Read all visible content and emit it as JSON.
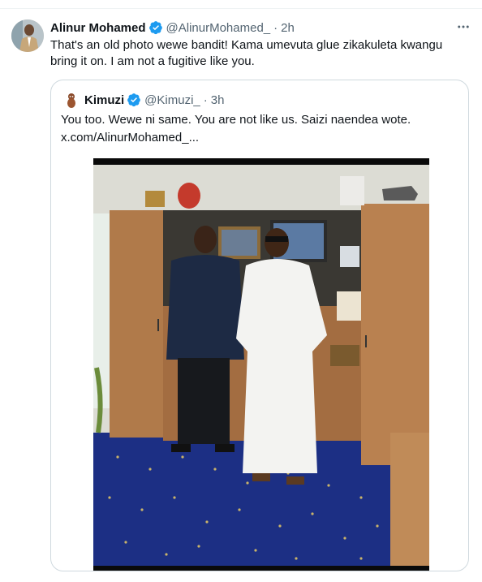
{
  "tweet": {
    "author_name": "Alinur Mohamed",
    "handle": "@AlinurMohamed_",
    "separator": "·",
    "time": "2h",
    "text": "That's an old photo wewe bandit! Kama umevuta glue zikakuleta kwangu bring it on. I am not a fugitive like you.",
    "verified_color": "#1d9bf0"
  },
  "quoted": {
    "author_name": "Kimuzi",
    "handle": "@Kimuzi_",
    "separator": "·",
    "time": "3h",
    "text_line1": "You too. Wewe ni same. You are not like us. Saizi naendea wote.",
    "text_line2": "x.com/AlinurMohamed_..."
  },
  "icons": {
    "verified": "verified-badge-icon",
    "more": "more-options-icon"
  }
}
